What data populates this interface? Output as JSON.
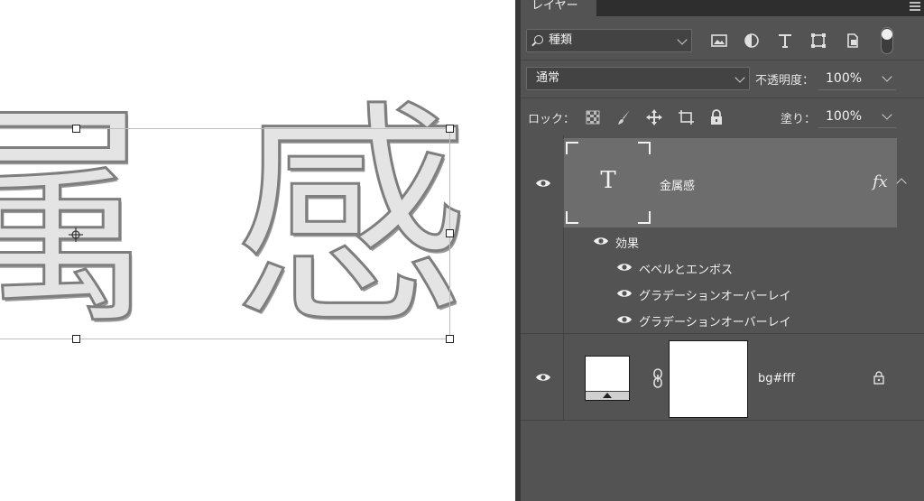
{
  "canvas": {
    "text": [
      "属",
      "感"
    ]
  },
  "panel": {
    "tab": "レイヤー",
    "filter": {
      "label": "種類",
      "icons": [
        "image-filter-icon",
        "adjustment-filter-icon",
        "type-filter-icon",
        "shape-filter-icon",
        "smart-object-filter-icon"
      ]
    },
    "blend_mode": "通常",
    "opacity_label": "不透明度：",
    "opacity": "100%",
    "lock_label": "ロック：",
    "fill_label": "塗り：",
    "fill": "100%",
    "layers": [
      {
        "name": "金属感",
        "type": "text",
        "thumb_glyph": "T",
        "fx": "fx",
        "effects_label": "効果",
        "effects": [
          "ベベルとエンボス",
          "グラデーションオーバーレイ",
          "グラデーションオーバーレイ"
        ]
      },
      {
        "name": "bg#fff",
        "type": "fill"
      }
    ]
  },
  "colors": {
    "panel_bg": "#535353",
    "selected_row": "#6d6d6d",
    "canvas_bg": "#ffffff"
  }
}
